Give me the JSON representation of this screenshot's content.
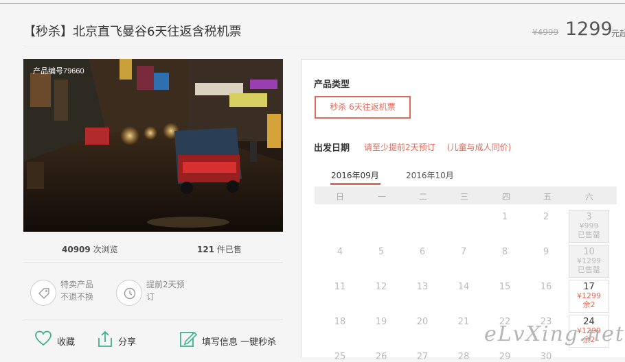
{
  "header": {
    "title": "【秒杀】北京直飞曼谷6天往返含税机票",
    "old_price": "¥4999",
    "price": "1299",
    "price_unit": "元起"
  },
  "product": {
    "id_label": "产品编号79660",
    "views_count": "40909",
    "views_label": "次浏览",
    "sold_count": "121",
    "sold_label": "件已售"
  },
  "features": [
    {
      "icon": "tag-icon",
      "line1": "特卖产品",
      "line2": "不退不换"
    },
    {
      "icon": "clock-icon",
      "line1": "提前2天预",
      "line2": "订"
    }
  ],
  "actions": {
    "favorite": "收藏",
    "share": "分享",
    "book": "填写信息 一键秒杀"
  },
  "booking": {
    "type_label": "产品类型",
    "type_option": "秒杀 6天往返机票",
    "date_label": "出发日期",
    "note1": "请至少提前2天预订",
    "note2": "(儿童与成人同价)",
    "months": [
      "2016年09月",
      "2016年10月"
    ],
    "weekdays": [
      "日",
      "一",
      "二",
      "三",
      "四",
      "五",
      "六"
    ],
    "rows": [
      [
        "",
        "",
        "",
        "",
        "1",
        "2",
        "3"
      ],
      [
        "4",
        "5",
        "6",
        "7",
        "8",
        "9",
        "10"
      ],
      [
        "11",
        "12",
        "13",
        "14",
        "15",
        "16",
        "17"
      ],
      [
        "18",
        "19",
        "20",
        "21",
        "22",
        "23",
        "24"
      ],
      [
        "25",
        "26",
        "27",
        "28",
        "29",
        "30",
        ""
      ]
    ],
    "cells": {
      "d3": {
        "day": "3",
        "price": "¥999",
        "status": "已售罄"
      },
      "d10": {
        "day": "10",
        "price": "¥1299",
        "status": "已售罄"
      },
      "d17": {
        "day": "17",
        "price": "¥1299",
        "status": "余2"
      },
      "d24": {
        "day": "24",
        "price": "¥1299",
        "status": "余2"
      }
    }
  },
  "watermark": "eLvXing.net",
  "colors": {
    "accent": "#e26a5a",
    "topline": "#49b6a3",
    "icon_green": "#3fb28f"
  }
}
